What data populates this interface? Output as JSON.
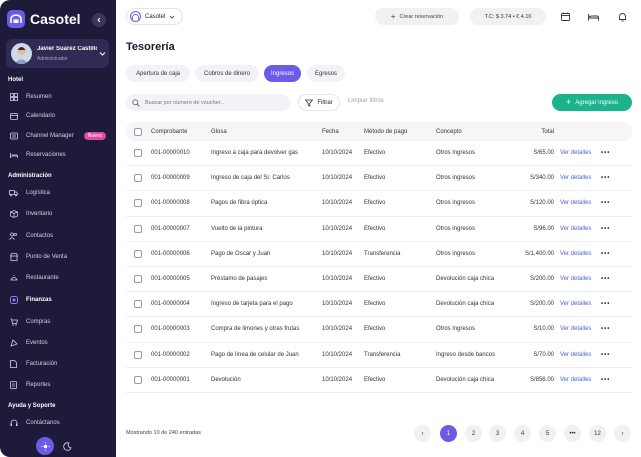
{
  "brand": {
    "name": "Casotel"
  },
  "user": {
    "name": "Javier Suarez Castillo",
    "role": "Administrador"
  },
  "nav": {
    "sections": [
      {
        "title": "Hotel",
        "items": [
          {
            "label": "Resumen",
            "icon": "grid-icon"
          },
          {
            "label": "Calendario",
            "icon": "calendar-icon"
          },
          {
            "label": "Channel Manager",
            "icon": "channel-icon",
            "badge": "Nuevo"
          },
          {
            "label": "Reservaciones",
            "icon": "bed-icon"
          }
        ]
      },
      {
        "title": "Administración",
        "items": [
          {
            "label": "Logística",
            "icon": "truck-icon"
          },
          {
            "label": "Inventario",
            "icon": "box-icon"
          },
          {
            "label": "Contactos",
            "icon": "users-icon"
          },
          {
            "label": "Punto de Venta",
            "icon": "store-icon"
          },
          {
            "label": "Restaurante",
            "icon": "dish-icon"
          },
          {
            "label": "Finanzas",
            "icon": "finance-icon",
            "active": true
          },
          {
            "label": "Compras",
            "icon": "cart-icon"
          },
          {
            "label": "Eventos",
            "icon": "event-icon"
          },
          {
            "label": "Facturación",
            "icon": "invoice-icon"
          },
          {
            "label": "Reportes",
            "icon": "report-icon"
          }
        ]
      },
      {
        "title": "Ayuda y Soporte",
        "items": [
          {
            "label": "Contáctanos",
            "icon": "headset-icon"
          }
        ]
      }
    ]
  },
  "topbar": {
    "company": "Casotel",
    "create_reservation": "Crear reservación",
    "exchange_rate": "T.C: $ 3.74  •  € 4.16"
  },
  "page": {
    "title": "Tesorería",
    "tabs": [
      "Apertura de caja",
      "Cobros de dinero",
      "Ingresos",
      "Egresos"
    ],
    "active_tab": 2,
    "search_placeholder": "Buscar por número de voucher...",
    "filter_label": "Filtrar",
    "clear_filters": "Limpiar filtros",
    "add_button": "Agregar ingreso"
  },
  "table": {
    "columns": [
      "Comprobante",
      "Glosa",
      "Fecha",
      "Método de pago",
      "Concepto",
      "Total"
    ],
    "rows": [
      {
        "comprobante": "001-00000010",
        "glosa": "Ingreso a caja para devolver gas",
        "fecha": "10/10/2024",
        "metodo": "Efectivo",
        "concepto": "Otros ingresos",
        "total": "S/65.00"
      },
      {
        "comprobante": "001-00000009",
        "glosa": "Ingreso de caja del Sr. Carlos",
        "fecha": "10/10/2024",
        "metodo": "Efectivo",
        "concepto": "Otros ingresos",
        "total": "S/340.00"
      },
      {
        "comprobante": "001-00000008",
        "glosa": "Pagos de fibra óptica",
        "fecha": "10/10/2024",
        "metodo": "Efectivo",
        "concepto": "Otros ingresos",
        "total": "S/120.00"
      },
      {
        "comprobante": "001-00000007",
        "glosa": "Vuelto de la pintura",
        "fecha": "10/10/2024",
        "metodo": "Efectivo",
        "concepto": "Otros ingresos",
        "total": "S/96.00"
      },
      {
        "comprobante": "001-00000006",
        "glosa": "Pago de Oscar y Juan",
        "fecha": "10/10/2024",
        "metodo": "Transferencia",
        "concepto": "Otros ingresos",
        "total": "S/1,400.00"
      },
      {
        "comprobante": "001-00000005",
        "glosa": "Préstamo de pasajes",
        "fecha": "10/10/2024",
        "metodo": "Efectivo",
        "concepto": "Devolución caja chica",
        "total": "S/200.00"
      },
      {
        "comprobante": "001-00000004",
        "glosa": "Ingreso de tarjeta para el pago",
        "fecha": "10/10/2024",
        "metodo": "Efectivo",
        "concepto": "Devolución caja chica",
        "total": "S/200.00"
      },
      {
        "comprobante": "001-00000003",
        "glosa": "Compra de limones y otras frutas",
        "fecha": "10/10/2024",
        "metodo": "Efectivo",
        "concepto": "Otros ingresos",
        "total": "S/10.00"
      },
      {
        "comprobante": "001-00000002",
        "glosa": "Pago de línea de celular de Juan",
        "fecha": "10/10/2024",
        "metodo": "Transferencia",
        "concepto": "Ingreso desde bancos",
        "total": "S/70.00"
      },
      {
        "comprobante": "001-00000001",
        "glosa": "Devolución",
        "fecha": "10/10/2024",
        "metodo": "Efectivo",
        "concepto": "Devolución caja chica",
        "total": "S/856.00"
      }
    ],
    "row_link": "Ver detalles",
    "row_more": "•••"
  },
  "pagination": {
    "info": "Mostrando 10 de 240 entradas",
    "pages": [
      "1",
      "2",
      "3",
      "4",
      "5",
      "•••",
      "12"
    ],
    "current": "1",
    "prev": "‹",
    "next": "›"
  },
  "colors": {
    "accent": "#6b5ce7",
    "sidebar": "#1d1a3a",
    "success": "#1bb38b",
    "link": "#4a5fd6",
    "badge": "#e04aa0"
  }
}
